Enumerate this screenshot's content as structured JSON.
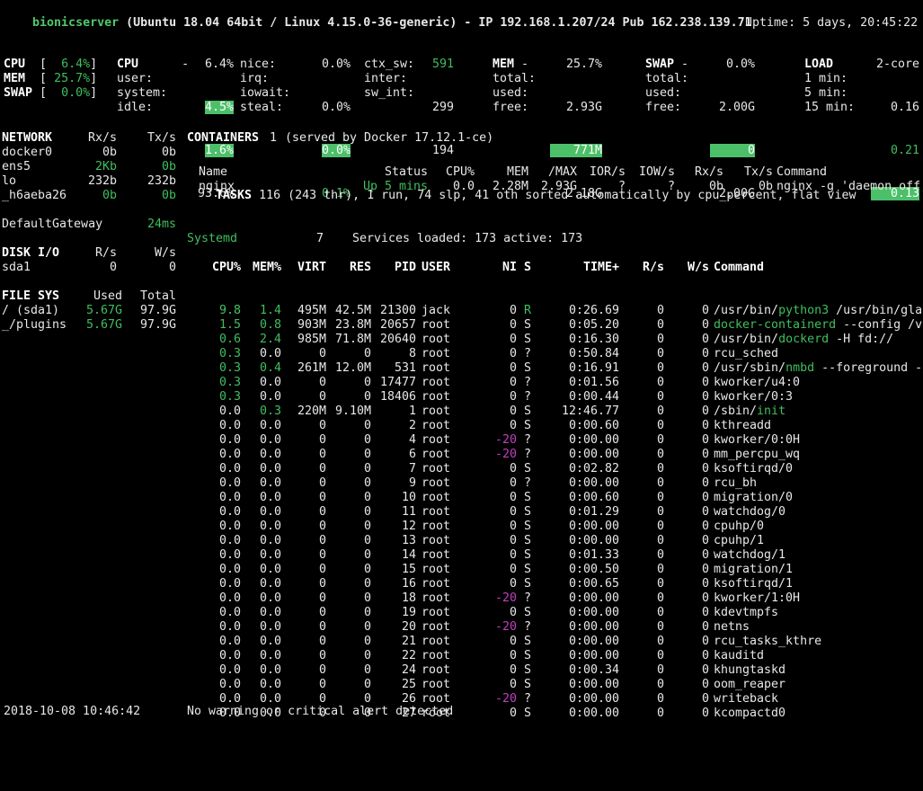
{
  "title": {
    "host": "bionicserver",
    "rest": " (Ubuntu 18.04 64bit / Linux 4.15.0-36-generic) - IP 192.168.1.207/24 Pub 162.238.139.71",
    "uptime_label": "Uptime:",
    "uptime_value": "5 days, 20:45:22"
  },
  "quicklook": {
    "rows": [
      {
        "label": "CPU ",
        "bracket_open": "[",
        "value": "  6.4%",
        "bracket_close": "]"
      },
      {
        "label": "MEM ",
        "bracket_open": "[",
        "value": " 25.7%",
        "bracket_close": "]"
      },
      {
        "label": "SWAP",
        "bracket_open": "[",
        "value": "  0.0%",
        "bracket_close": "]"
      }
    ]
  },
  "cpu": {
    "header_label": "CPU",
    "header_dash": "-",
    "header_value": "6.4%",
    "left": [
      {
        "label": "user:",
        "value": "4.5%",
        "highlight": true
      },
      {
        "label": "system:",
        "value": "1.6%",
        "highlight": true
      },
      {
        "label": "idle:",
        "value": "93.6%",
        "highlight": false
      }
    ],
    "right": [
      {
        "label": "nice:",
        "value": "0.0%",
        "highlight": false
      },
      {
        "label": "irq:",
        "value": "0.0%",
        "highlight": false
      },
      {
        "label": "iowait:",
        "value": "0.0%",
        "highlight": true
      },
      {
        "label": "steal:",
        "value": "0.1%",
        "highlight": false,
        "green": true
      }
    ],
    "counters": [
      {
        "label": "ctx_sw:",
        "value": "591",
        "green": true
      },
      {
        "label": "inter:",
        "value": "299",
        "green": false
      },
      {
        "label": "sw_int:",
        "value": "194",
        "green": false
      }
    ]
  },
  "mem": {
    "header_label": "MEM",
    "header_dash": "-",
    "header_value": "25.7%",
    "rows": [
      {
        "label": "total:",
        "value": "2.93G",
        "highlight": false
      },
      {
        "label": "used:",
        "value": "771M",
        "highlight": true
      },
      {
        "label": "free:",
        "value": "2.18G",
        "highlight": false
      }
    ]
  },
  "swap": {
    "header_label": "SWAP",
    "header_dash": "-",
    "header_value": "0.0%",
    "rows": [
      {
        "label": "total:",
        "value": "2.00G",
        "highlight": false
      },
      {
        "label": "used:",
        "value": "0",
        "highlight": true
      },
      {
        "label": "free:",
        "value": "2.00G",
        "highlight": false
      }
    ]
  },
  "load": {
    "header_label": "LOAD",
    "header_value": "2-core",
    "rows": [
      {
        "label": "1 min:",
        "value": "0.16",
        "highlight": false,
        "green": false
      },
      {
        "label": "5 min:",
        "value": "0.21",
        "highlight": false,
        "green": true
      },
      {
        "label": "15 min:",
        "value": "0.13",
        "highlight": true,
        "green": false
      }
    ]
  },
  "network": {
    "title": "NETWORK",
    "col_rx": "Rx/s",
    "col_tx": "Tx/s",
    "rows": [
      {
        "name": "docker0",
        "rx": "0b",
        "tx": "0b",
        "rx_green": false,
        "tx_green": false
      },
      {
        "name": "ens5",
        "rx": "2Kb",
        "tx": "0b",
        "rx_green": true,
        "tx_green": true
      },
      {
        "name": "lo",
        "rx": "232b",
        "tx": "232b",
        "rx_green": false,
        "tx_green": false
      },
      {
        "name": "_h6aeba26",
        "rx": "0b",
        "tx": "0b",
        "rx_green": true,
        "tx_green": true
      }
    ],
    "gateway_label": "DefaultGateway",
    "gateway_value": "24ms"
  },
  "diskio": {
    "title": "DISK I/O",
    "col_r": "R/s",
    "col_w": "W/s",
    "rows": [
      {
        "name": "sda1",
        "r": "0",
        "w": "0"
      }
    ]
  },
  "filesys": {
    "title": "FILE SYS",
    "col_used": "Used",
    "col_total": "Total",
    "rows": [
      {
        "name": "/ (sda1)",
        "used": "5.67G",
        "total": "97.9G"
      },
      {
        "name": "_/plugins",
        "used": "5.67G",
        "total": "97.9G"
      }
    ]
  },
  "containers": {
    "title": "CONTAINERS",
    "count": "1",
    "served_by": "(served by Docker 17.12.1-ce)",
    "headers": [
      "Name",
      "Status",
      "CPU%",
      "MEM",
      "/MAX",
      "IOR/s",
      "IOW/s",
      "Rx/s",
      "Tx/s",
      "Command"
    ],
    "rows": [
      {
        "name": "nginx",
        "status": "Up 5 mins",
        "cpu": "0.0",
        "mem": "2.28M",
        "max": "2.93G",
        "ior": "?",
        "iow": "?",
        "rx": "0b",
        "tx": "0b",
        "command": "nginx -g 'daemon off;"
      }
    ]
  },
  "tasks": {
    "title": "TASKS",
    "summary": "116 (243 thr), 1 run, 74 slp, 41 oth sorted automatically by cpu_percent, flat view"
  },
  "systemd": {
    "label": "Systemd",
    "count": "7",
    "detail": "Services loaded: 173 active: 173"
  },
  "processes": {
    "headers": [
      "CPU%",
      "MEM%",
      "VIRT",
      "RES",
      "PID",
      "USER",
      "NI",
      "S",
      "TIME+",
      "R/s",
      "W/s",
      "Command"
    ],
    "rows": [
      {
        "cpu": "9.8",
        "cpu_c": "gb",
        "mem": "1.4",
        "mem_c": "g",
        "virt": "495M",
        "res": "42.5M",
        "pid": "21300",
        "user": "jack",
        "ni": "0",
        "ni_c": "w",
        "s": "R",
        "s_c": "g",
        "time": "0:26.69",
        "r": "0",
        "w": "0",
        "cmd_pre": "/usr/bin/",
        "cmd_hi": "python3",
        "cmd_post": " /usr/bin/glance"
      },
      {
        "cpu": "1.5",
        "cpu_c": "g",
        "mem": "0.8",
        "mem_c": "g",
        "virt": "903M",
        "res": "23.8M",
        "pid": "20657",
        "user": "root",
        "ni": "0",
        "ni_c": "w",
        "s": "S",
        "s_c": "w",
        "time": "0:05.20",
        "r": "0",
        "w": "0",
        "cmd_pre": "",
        "cmd_hi": "docker-containerd",
        "cmd_post": " --config /var/"
      },
      {
        "cpu": "0.6",
        "cpu_c": "g",
        "mem": "2.4",
        "mem_c": "g",
        "virt": "985M",
        "res": "71.8M",
        "pid": "20640",
        "user": "root",
        "ni": "0",
        "ni_c": "w",
        "s": "S",
        "s_c": "w",
        "time": "0:16.30",
        "r": "0",
        "w": "0",
        "cmd_pre": "/usr/bin/",
        "cmd_hi": "dockerd",
        "cmd_post": " -H fd://"
      },
      {
        "cpu": "0.3",
        "cpu_c": "g",
        "mem": "0.0",
        "mem_c": "w",
        "virt": "0",
        "res": "0",
        "pid": "8",
        "user": "root",
        "ni": "0",
        "ni_c": "w",
        "s": "?",
        "s_c": "w",
        "time": "0:50.84",
        "r": "0",
        "w": "0",
        "cmd_pre": "rcu_sched",
        "cmd_hi": "",
        "cmd_post": ""
      },
      {
        "cpu": "0.3",
        "cpu_c": "g",
        "mem": "0.4",
        "mem_c": "g",
        "virt": "261M",
        "res": "12.0M",
        "pid": "531",
        "user": "root",
        "ni": "0",
        "ni_c": "w",
        "s": "S",
        "s_c": "w",
        "time": "0:16.91",
        "r": "0",
        "w": "0",
        "cmd_pre": "/usr/sbin/",
        "cmd_hi": "nmbd",
        "cmd_post": " --foreground --no"
      },
      {
        "cpu": "0.3",
        "cpu_c": "g",
        "mem": "0.0",
        "mem_c": "w",
        "virt": "0",
        "res": "0",
        "pid": "17477",
        "user": "root",
        "ni": "0",
        "ni_c": "w",
        "s": "?",
        "s_c": "w",
        "time": "0:01.56",
        "r": "0",
        "w": "0",
        "cmd_pre": "kworker/u4:0",
        "cmd_hi": "",
        "cmd_post": ""
      },
      {
        "cpu": "0.3",
        "cpu_c": "g",
        "mem": "0.0",
        "mem_c": "w",
        "virt": "0",
        "res": "0",
        "pid": "18406",
        "user": "root",
        "ni": "0",
        "ni_c": "w",
        "s": "?",
        "s_c": "w",
        "time": "0:00.44",
        "r": "0",
        "w": "0",
        "cmd_pre": "kworker/0:3",
        "cmd_hi": "",
        "cmd_post": ""
      },
      {
        "cpu": "0.0",
        "cpu_c": "w",
        "mem": "0.3",
        "mem_c": "g",
        "virt": "220M",
        "res": "9.10M",
        "pid": "1",
        "user": "root",
        "ni": "0",
        "ni_c": "w",
        "s": "S",
        "s_c": "w",
        "time": "12:46.77",
        "r": "0",
        "w": "0",
        "cmd_pre": "/sbin/",
        "cmd_hi": "init",
        "cmd_post": ""
      },
      {
        "cpu": "0.0",
        "cpu_c": "w",
        "mem": "0.0",
        "mem_c": "w",
        "virt": "0",
        "res": "0",
        "pid": "2",
        "user": "root",
        "ni": "0",
        "ni_c": "w",
        "s": "S",
        "s_c": "w",
        "time": "0:00.60",
        "r": "0",
        "w": "0",
        "cmd_pre": "kthreadd",
        "cmd_hi": "",
        "cmd_post": ""
      },
      {
        "cpu": "0.0",
        "cpu_c": "w",
        "mem": "0.0",
        "mem_c": "w",
        "virt": "0",
        "res": "0",
        "pid": "4",
        "user": "root",
        "ni": "-20",
        "ni_c": "mag",
        "s": "?",
        "s_c": "w",
        "time": "0:00.00",
        "r": "0",
        "w": "0",
        "cmd_pre": "kworker/0:0H",
        "cmd_hi": "",
        "cmd_post": ""
      },
      {
        "cpu": "0.0",
        "cpu_c": "w",
        "mem": "0.0",
        "mem_c": "w",
        "virt": "0",
        "res": "0",
        "pid": "6",
        "user": "root",
        "ni": "-20",
        "ni_c": "mag",
        "s": "?",
        "s_c": "w",
        "time": "0:00.00",
        "r": "0",
        "w": "0",
        "cmd_pre": "mm_percpu_wq",
        "cmd_hi": "",
        "cmd_post": ""
      },
      {
        "cpu": "0.0",
        "cpu_c": "w",
        "mem": "0.0",
        "mem_c": "w",
        "virt": "0",
        "res": "0",
        "pid": "7",
        "user": "root",
        "ni": "0",
        "ni_c": "w",
        "s": "S",
        "s_c": "w",
        "time": "0:02.82",
        "r": "0",
        "w": "0",
        "cmd_pre": "ksoftirqd/0",
        "cmd_hi": "",
        "cmd_post": ""
      },
      {
        "cpu": "0.0",
        "cpu_c": "w",
        "mem": "0.0",
        "mem_c": "w",
        "virt": "0",
        "res": "0",
        "pid": "9",
        "user": "root",
        "ni": "0",
        "ni_c": "w",
        "s": "?",
        "s_c": "w",
        "time": "0:00.00",
        "r": "0",
        "w": "0",
        "cmd_pre": "rcu_bh",
        "cmd_hi": "",
        "cmd_post": ""
      },
      {
        "cpu": "0.0",
        "cpu_c": "w",
        "mem": "0.0",
        "mem_c": "w",
        "virt": "0",
        "res": "0",
        "pid": "10",
        "user": "root",
        "ni": "0",
        "ni_c": "w",
        "s": "S",
        "s_c": "w",
        "time": "0:00.60",
        "r": "0",
        "w": "0",
        "cmd_pre": "migration/0",
        "cmd_hi": "",
        "cmd_post": ""
      },
      {
        "cpu": "0.0",
        "cpu_c": "w",
        "mem": "0.0",
        "mem_c": "w",
        "virt": "0",
        "res": "0",
        "pid": "11",
        "user": "root",
        "ni": "0",
        "ni_c": "w",
        "s": "S",
        "s_c": "w",
        "time": "0:01.29",
        "r": "0",
        "w": "0",
        "cmd_pre": "watchdog/0",
        "cmd_hi": "",
        "cmd_post": ""
      },
      {
        "cpu": "0.0",
        "cpu_c": "w",
        "mem": "0.0",
        "mem_c": "w",
        "virt": "0",
        "res": "0",
        "pid": "12",
        "user": "root",
        "ni": "0",
        "ni_c": "w",
        "s": "S",
        "s_c": "w",
        "time": "0:00.00",
        "r": "0",
        "w": "0",
        "cmd_pre": "cpuhp/0",
        "cmd_hi": "",
        "cmd_post": ""
      },
      {
        "cpu": "0.0",
        "cpu_c": "w",
        "mem": "0.0",
        "mem_c": "w",
        "virt": "0",
        "res": "0",
        "pid": "13",
        "user": "root",
        "ni": "0",
        "ni_c": "w",
        "s": "S",
        "s_c": "w",
        "time": "0:00.00",
        "r": "0",
        "w": "0",
        "cmd_pre": "cpuhp/1",
        "cmd_hi": "",
        "cmd_post": ""
      },
      {
        "cpu": "0.0",
        "cpu_c": "w",
        "mem": "0.0",
        "mem_c": "w",
        "virt": "0",
        "res": "0",
        "pid": "14",
        "user": "root",
        "ni": "0",
        "ni_c": "w",
        "s": "S",
        "s_c": "w",
        "time": "0:01.33",
        "r": "0",
        "w": "0",
        "cmd_pre": "watchdog/1",
        "cmd_hi": "",
        "cmd_post": ""
      },
      {
        "cpu": "0.0",
        "cpu_c": "w",
        "mem": "0.0",
        "mem_c": "w",
        "virt": "0",
        "res": "0",
        "pid": "15",
        "user": "root",
        "ni": "0",
        "ni_c": "w",
        "s": "S",
        "s_c": "w",
        "time": "0:00.50",
        "r": "0",
        "w": "0",
        "cmd_pre": "migration/1",
        "cmd_hi": "",
        "cmd_post": ""
      },
      {
        "cpu": "0.0",
        "cpu_c": "w",
        "mem": "0.0",
        "mem_c": "w",
        "virt": "0",
        "res": "0",
        "pid": "16",
        "user": "root",
        "ni": "0",
        "ni_c": "w",
        "s": "S",
        "s_c": "w",
        "time": "0:00.65",
        "r": "0",
        "w": "0",
        "cmd_pre": "ksoftirqd/1",
        "cmd_hi": "",
        "cmd_post": ""
      },
      {
        "cpu": "0.0",
        "cpu_c": "w",
        "mem": "0.0",
        "mem_c": "w",
        "virt": "0",
        "res": "0",
        "pid": "18",
        "user": "root",
        "ni": "-20",
        "ni_c": "mag",
        "s": "?",
        "s_c": "w",
        "time": "0:00.00",
        "r": "0",
        "w": "0",
        "cmd_pre": "kworker/1:0H",
        "cmd_hi": "",
        "cmd_post": ""
      },
      {
        "cpu": "0.0",
        "cpu_c": "w",
        "mem": "0.0",
        "mem_c": "w",
        "virt": "0",
        "res": "0",
        "pid": "19",
        "user": "root",
        "ni": "0",
        "ni_c": "w",
        "s": "S",
        "s_c": "w",
        "time": "0:00.00",
        "r": "0",
        "w": "0",
        "cmd_pre": "kdevtmpfs",
        "cmd_hi": "",
        "cmd_post": ""
      },
      {
        "cpu": "0.0",
        "cpu_c": "w",
        "mem": "0.0",
        "mem_c": "w",
        "virt": "0",
        "res": "0",
        "pid": "20",
        "user": "root",
        "ni": "-20",
        "ni_c": "mag",
        "s": "?",
        "s_c": "w",
        "time": "0:00.00",
        "r": "0",
        "w": "0",
        "cmd_pre": "netns",
        "cmd_hi": "",
        "cmd_post": ""
      },
      {
        "cpu": "0.0",
        "cpu_c": "w",
        "mem": "0.0",
        "mem_c": "w",
        "virt": "0",
        "res": "0",
        "pid": "21",
        "user": "root",
        "ni": "0",
        "ni_c": "w",
        "s": "S",
        "s_c": "w",
        "time": "0:00.00",
        "r": "0",
        "w": "0",
        "cmd_pre": "rcu_tasks_kthre",
        "cmd_hi": "",
        "cmd_post": ""
      },
      {
        "cpu": "0.0",
        "cpu_c": "w",
        "mem": "0.0",
        "mem_c": "w",
        "virt": "0",
        "res": "0",
        "pid": "22",
        "user": "root",
        "ni": "0",
        "ni_c": "w",
        "s": "S",
        "s_c": "w",
        "time": "0:00.00",
        "r": "0",
        "w": "0",
        "cmd_pre": "kauditd",
        "cmd_hi": "",
        "cmd_post": ""
      },
      {
        "cpu": "0.0",
        "cpu_c": "w",
        "mem": "0.0",
        "mem_c": "w",
        "virt": "0",
        "res": "0",
        "pid": "24",
        "user": "root",
        "ni": "0",
        "ni_c": "w",
        "s": "S",
        "s_c": "w",
        "time": "0:00.34",
        "r": "0",
        "w": "0",
        "cmd_pre": "khungtaskd",
        "cmd_hi": "",
        "cmd_post": ""
      },
      {
        "cpu": "0.0",
        "cpu_c": "w",
        "mem": "0.0",
        "mem_c": "w",
        "virt": "0",
        "res": "0",
        "pid": "25",
        "user": "root",
        "ni": "0",
        "ni_c": "w",
        "s": "S",
        "s_c": "w",
        "time": "0:00.00",
        "r": "0",
        "w": "0",
        "cmd_pre": "oom_reaper",
        "cmd_hi": "",
        "cmd_post": ""
      },
      {
        "cpu": "0.0",
        "cpu_c": "w",
        "mem": "0.0",
        "mem_c": "w",
        "virt": "0",
        "res": "0",
        "pid": "26",
        "user": "root",
        "ni": "-20",
        "ni_c": "mag",
        "s": "?",
        "s_c": "w",
        "time": "0:00.00",
        "r": "0",
        "w": "0",
        "cmd_pre": "writeback",
        "cmd_hi": "",
        "cmd_post": ""
      },
      {
        "cpu": "0.0",
        "cpu_c": "w",
        "mem": "0.0",
        "mem_c": "w",
        "virt": "0",
        "res": "0",
        "pid": "27",
        "user": "root",
        "ni": "0",
        "ni_c": "w",
        "s": "S",
        "s_c": "w",
        "time": "0:00.00",
        "r": "0",
        "w": "0",
        "cmd_pre": "kcompactd0",
        "cmd_hi": "",
        "cmd_post": ""
      }
    ]
  },
  "statusbar": {
    "datetime": "2018-10-08 10:46:42",
    "alert": "No warning or critical alert detected"
  },
  "colors": {
    "background": "#000000",
    "foreground": "#d8d8d8",
    "accent_green": "#3fbf5f",
    "highlight_bg": "#4cc069",
    "nice_magenta": "#bf40bf",
    "title_green": "#4fc96c"
  }
}
